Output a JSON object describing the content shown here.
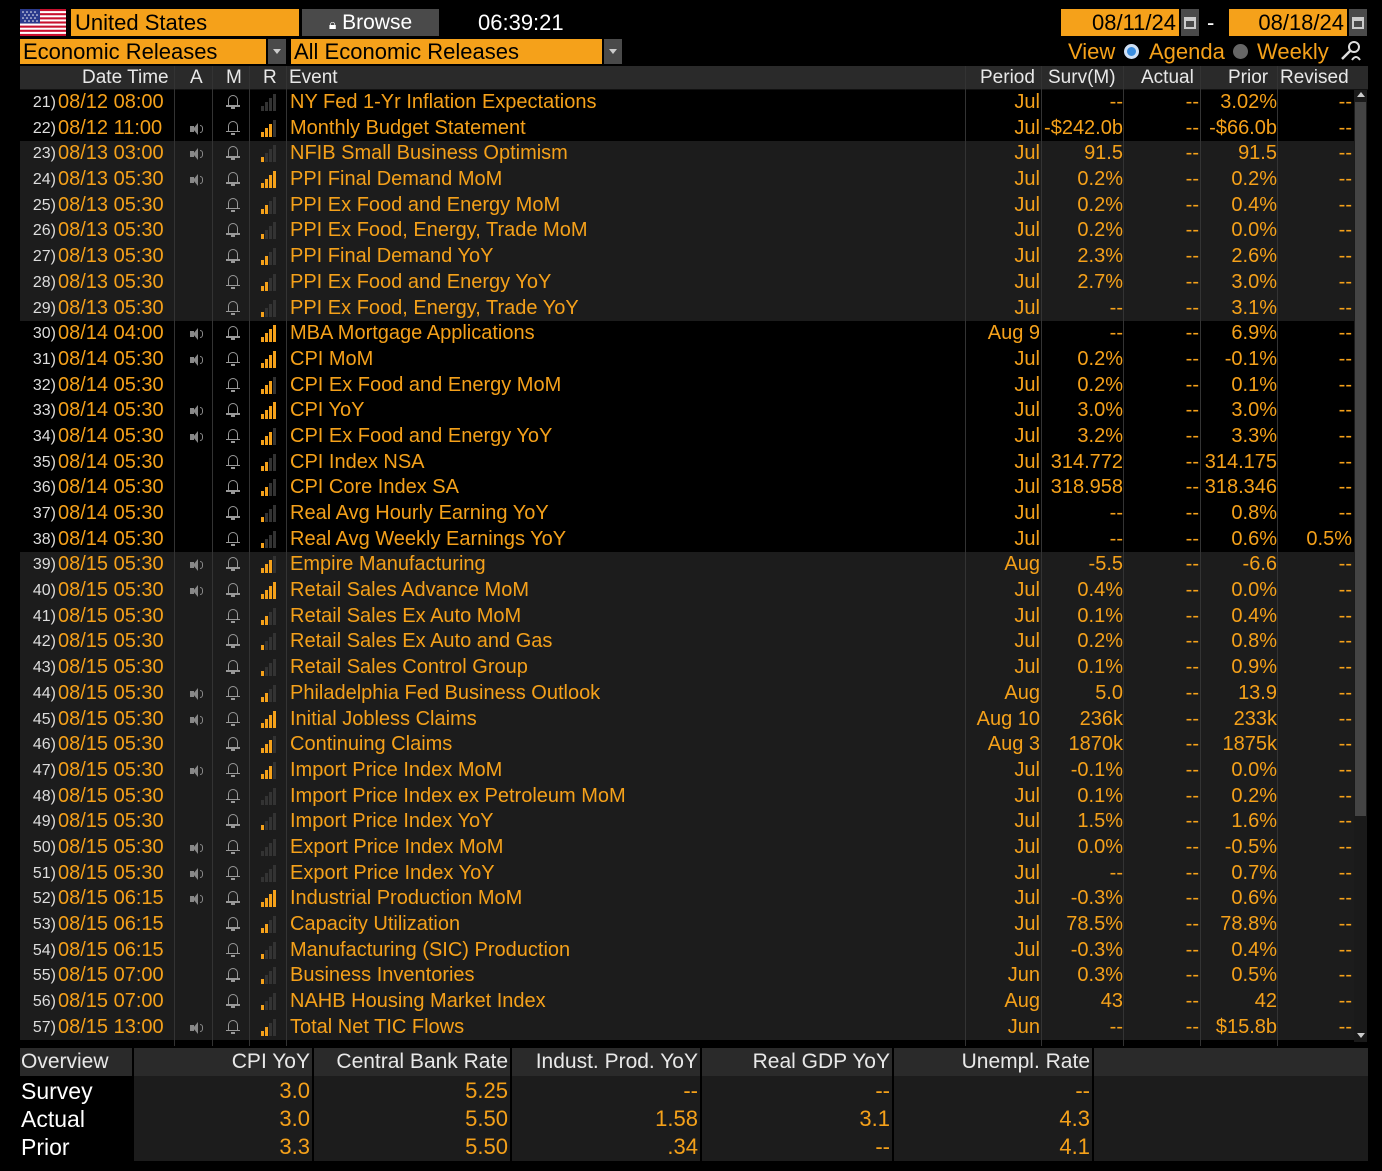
{
  "header": {
    "country": "United States",
    "browse_label": "Browse",
    "browse_icon": "lock-icon",
    "time": "06:39:21",
    "start_date": "08/11/24",
    "separator": "-",
    "end_date": "08/18/24",
    "category_dropdown": "Economic Releases",
    "filter_dropdown": "All Economic Releases",
    "view_label": "View",
    "view_options": [
      "Agenda",
      "Weekly"
    ],
    "view_selected": "Agenda"
  },
  "columns": [
    "Date Time",
    "A",
    "M",
    "R",
    "Event",
    "Period",
    "Surv(M)",
    "Actual",
    "Prior",
    "Revised"
  ],
  "rows": [
    {
      "n": "21)",
      "dt": "08/12 08:00",
      "a": false,
      "r": 0,
      "ev": "NY Fed 1-Yr Inflation Expectations",
      "per": "Jul",
      "surv": "--",
      "act": "--",
      "pri": "3.02%",
      "rev": "--"
    },
    {
      "n": "22)",
      "dt": "08/12 11:00",
      "a": true,
      "r": 3,
      "ev": "Monthly Budget Statement",
      "per": "Jul",
      "surv": "-$242.0b",
      "act": "--",
      "pri": "-$66.0b",
      "rev": "--"
    },
    {
      "n": "23)",
      "dt": "08/13 03:00",
      "a": true,
      "r": 1,
      "ev": "NFIB Small Business Optimism",
      "per": "Jul",
      "surv": "91.5",
      "act": "--",
      "pri": "91.5",
      "rev": "--"
    },
    {
      "n": "24)",
      "dt": "08/13 05:30",
      "a": true,
      "r": 4,
      "ev": "PPI Final Demand MoM",
      "per": "Jul",
      "surv": "0.2%",
      "act": "--",
      "pri": "0.2%",
      "rev": "--"
    },
    {
      "n": "25)",
      "dt": "08/13 05:30",
      "a": false,
      "r": 2,
      "ev": "PPI Ex Food and Energy MoM",
      "per": "Jul",
      "surv": "0.2%",
      "act": "--",
      "pri": "0.4%",
      "rev": "--"
    },
    {
      "n": "26)",
      "dt": "08/13 05:30",
      "a": false,
      "r": 1,
      "ev": "PPI Ex Food, Energy, Trade MoM",
      "per": "Jul",
      "surv": "0.2%",
      "act": "--",
      "pri": "0.0%",
      "rev": "--"
    },
    {
      "n": "27)",
      "dt": "08/13 05:30",
      "a": false,
      "r": 2,
      "ev": "PPI Final Demand YoY",
      "per": "Jul",
      "surv": "2.3%",
      "act": "--",
      "pri": "2.6%",
      "rev": "--"
    },
    {
      "n": "28)",
      "dt": "08/13 05:30",
      "a": false,
      "r": 2,
      "ev": "PPI Ex Food and Energy YoY",
      "per": "Jul",
      "surv": "2.7%",
      "act": "--",
      "pri": "3.0%",
      "rev": "--"
    },
    {
      "n": "29)",
      "dt": "08/13 05:30",
      "a": false,
      "r": 1,
      "ev": "PPI Ex Food, Energy, Trade YoY",
      "per": "Jul",
      "surv": "--",
      "act": "--",
      "pri": "3.1%",
      "rev": "--"
    },
    {
      "n": "30)",
      "dt": "08/14 04:00",
      "a": true,
      "r": 4,
      "ev": "MBA Mortgage Applications",
      "per": "Aug 9",
      "surv": "--",
      "act": "--",
      "pri": "6.9%",
      "rev": "--"
    },
    {
      "n": "31)",
      "dt": "08/14 05:30",
      "a": true,
      "r": 4,
      "ev": "CPI MoM",
      "per": "Jul",
      "surv": "0.2%",
      "act": "--",
      "pri": "-0.1%",
      "rev": "--"
    },
    {
      "n": "32)",
      "dt": "08/14 05:30",
      "a": false,
      "r": 3,
      "ev": "CPI Ex Food and Energy MoM",
      "per": "Jul",
      "surv": "0.2%",
      "act": "--",
      "pri": "0.1%",
      "rev": "--"
    },
    {
      "n": "33)",
      "dt": "08/14 05:30",
      "a": true,
      "r": 4,
      "ev": "CPI YoY",
      "per": "Jul",
      "surv": "3.0%",
      "act": "--",
      "pri": "3.0%",
      "rev": "--"
    },
    {
      "n": "34)",
      "dt": "08/14 05:30",
      "a": true,
      "r": 3,
      "ev": "CPI Ex Food and Energy YoY",
      "per": "Jul",
      "surv": "3.2%",
      "act": "--",
      "pri": "3.3%",
      "rev": "--"
    },
    {
      "n": "35)",
      "dt": "08/14 05:30",
      "a": false,
      "r": 2,
      "ev": "CPI Index NSA",
      "per": "Jul",
      "surv": "314.772",
      "act": "--",
      "pri": "314.175",
      "rev": "--"
    },
    {
      "n": "36)",
      "dt": "08/14 05:30",
      "a": false,
      "r": 2,
      "ev": "CPI Core Index SA",
      "per": "Jul",
      "surv": "318.958",
      "act": "--",
      "pri": "318.346",
      "rev": "--"
    },
    {
      "n": "37)",
      "dt": "08/14 05:30",
      "a": false,
      "r": 1,
      "ev": "Real Avg Hourly Earning YoY",
      "per": "Jul",
      "surv": "--",
      "act": "--",
      "pri": "0.8%",
      "rev": "--"
    },
    {
      "n": "38)",
      "dt": "08/14 05:30",
      "a": false,
      "r": 1,
      "ev": "Real Avg Weekly Earnings YoY",
      "per": "Jul",
      "surv": "--",
      "act": "--",
      "pri": "0.6%",
      "rev": "0.5%"
    },
    {
      "n": "39)",
      "dt": "08/15 05:30",
      "a": true,
      "r": 3,
      "ev": "Empire Manufacturing",
      "per": "Aug",
      "surv": "-5.5",
      "act": "--",
      "pri": "-6.6",
      "rev": "--"
    },
    {
      "n": "40)",
      "dt": "08/15 05:30",
      "a": true,
      "r": 4,
      "ev": "Retail Sales Advance MoM",
      "per": "Jul",
      "surv": "0.4%",
      "act": "--",
      "pri": "0.0%",
      "rev": "--"
    },
    {
      "n": "41)",
      "dt": "08/15 05:30",
      "a": false,
      "r": 2,
      "ev": "Retail Sales Ex Auto MoM",
      "per": "Jul",
      "surv": "0.1%",
      "act": "--",
      "pri": "0.4%",
      "rev": "--"
    },
    {
      "n": "42)",
      "dt": "08/15 05:30",
      "a": false,
      "r": 1,
      "ev": "Retail Sales Ex Auto and Gas",
      "per": "Jul",
      "surv": "0.2%",
      "act": "--",
      "pri": "0.8%",
      "rev": "--"
    },
    {
      "n": "43)",
      "dt": "08/15 05:30",
      "a": false,
      "r": 1,
      "ev": "Retail Sales Control Group",
      "per": "Jul",
      "surv": "0.1%",
      "act": "--",
      "pri": "0.9%",
      "rev": "--"
    },
    {
      "n": "44)",
      "dt": "08/15 05:30",
      "a": true,
      "r": 2,
      "ev": "Philadelphia Fed Business Outlook",
      "per": "Aug",
      "surv": "5.0",
      "act": "--",
      "pri": "13.9",
      "rev": "--"
    },
    {
      "n": "45)",
      "dt": "08/15 05:30",
      "a": true,
      "r": 4,
      "ev": "Initial Jobless Claims",
      "per": "Aug 10",
      "surv": "236k",
      "act": "--",
      "pri": "233k",
      "rev": "--"
    },
    {
      "n": "46)",
      "dt": "08/15 05:30",
      "a": false,
      "r": 3,
      "ev": "Continuing Claims",
      "per": "Aug 3",
      "surv": "1870k",
      "act": "--",
      "pri": "1875k",
      "rev": "--"
    },
    {
      "n": "47)",
      "dt": "08/15 05:30",
      "a": true,
      "r": 3,
      "ev": "Import Price Index MoM",
      "per": "Jul",
      "surv": "-0.1%",
      "act": "--",
      "pri": "0.0%",
      "rev": "--"
    },
    {
      "n": "48)",
      "dt": "08/15 05:30",
      "a": false,
      "r": 0,
      "ev": "Import Price Index ex Petroleum MoM",
      "per": "Jul",
      "surv": "0.1%",
      "act": "--",
      "pri": "0.2%",
      "rev": "--"
    },
    {
      "n": "49)",
      "dt": "08/15 05:30",
      "a": false,
      "r": 1,
      "ev": "Import Price Index YoY",
      "per": "Jul",
      "surv": "1.5%",
      "act": "--",
      "pri": "1.6%",
      "rev": "--"
    },
    {
      "n": "50)",
      "dt": "08/15 05:30",
      "a": true,
      "r": 0,
      "ev": "Export Price Index MoM",
      "per": "Jul",
      "surv": "0.0%",
      "act": "--",
      "pri": "-0.5%",
      "rev": "--"
    },
    {
      "n": "51)",
      "dt": "08/15 05:30",
      "a": true,
      "r": 0,
      "ev": "Export Price Index YoY",
      "per": "Jul",
      "surv": "--",
      "act": "--",
      "pri": "0.7%",
      "rev": "--"
    },
    {
      "n": "52)",
      "dt": "08/15 06:15",
      "a": true,
      "r": 4,
      "ev": "Industrial Production MoM",
      "per": "Jul",
      "surv": "-0.3%",
      "act": "--",
      "pri": "0.6%",
      "rev": "--"
    },
    {
      "n": "53)",
      "dt": "08/15 06:15",
      "a": false,
      "r": 2,
      "ev": "Capacity Utilization",
      "per": "Jul",
      "surv": "78.5%",
      "act": "--",
      "pri": "78.8%",
      "rev": "--"
    },
    {
      "n": "54)",
      "dt": "08/15 06:15",
      "a": false,
      "r": 1,
      "ev": "Manufacturing (SIC) Production",
      "per": "Jul",
      "surv": "-0.3%",
      "act": "--",
      "pri": "0.4%",
      "rev": "--"
    },
    {
      "n": "55)",
      "dt": "08/15 07:00",
      "a": false,
      "r": 1,
      "ev": "Business Inventories",
      "per": "Jun",
      "surv": "0.3%",
      "act": "--",
      "pri": "0.5%",
      "rev": "--"
    },
    {
      "n": "56)",
      "dt": "08/15 07:00",
      "a": false,
      "r": 1,
      "ev": "NAHB Housing Market Index",
      "per": "Aug",
      "surv": "43",
      "act": "--",
      "pri": "42",
      "rev": "--"
    },
    {
      "n": "57)",
      "dt": "08/15 13:00",
      "a": true,
      "r": 2,
      "ev": "Total Net TIC Flows",
      "per": "Jun",
      "surv": "--",
      "act": "--",
      "pri": "$15.8b",
      "rev": "--"
    }
  ],
  "overview": {
    "title": "Overview",
    "headers": [
      "CPI YoY",
      "Central Bank Rate",
      "Indust. Prod. YoY",
      "Real GDP YoY",
      "Unempl. Rate"
    ],
    "rows": [
      {
        "label": "Survey",
        "values": [
          "3.0",
          "5.25",
          "--",
          "--",
          "--"
        ]
      },
      {
        "label": "Actual",
        "values": [
          "3.0",
          "5.50",
          "1.58",
          "3.1",
          "4.3"
        ]
      },
      {
        "label": "Prior",
        "values": [
          "3.3",
          "5.50",
          ".34",
          "--",
          "4.1"
        ]
      }
    ]
  },
  "colors": {
    "accent": "#f5a11a",
    "background": "#000000",
    "header_bg": "#2a2a2a",
    "alt_row": "#1c1c1c"
  }
}
